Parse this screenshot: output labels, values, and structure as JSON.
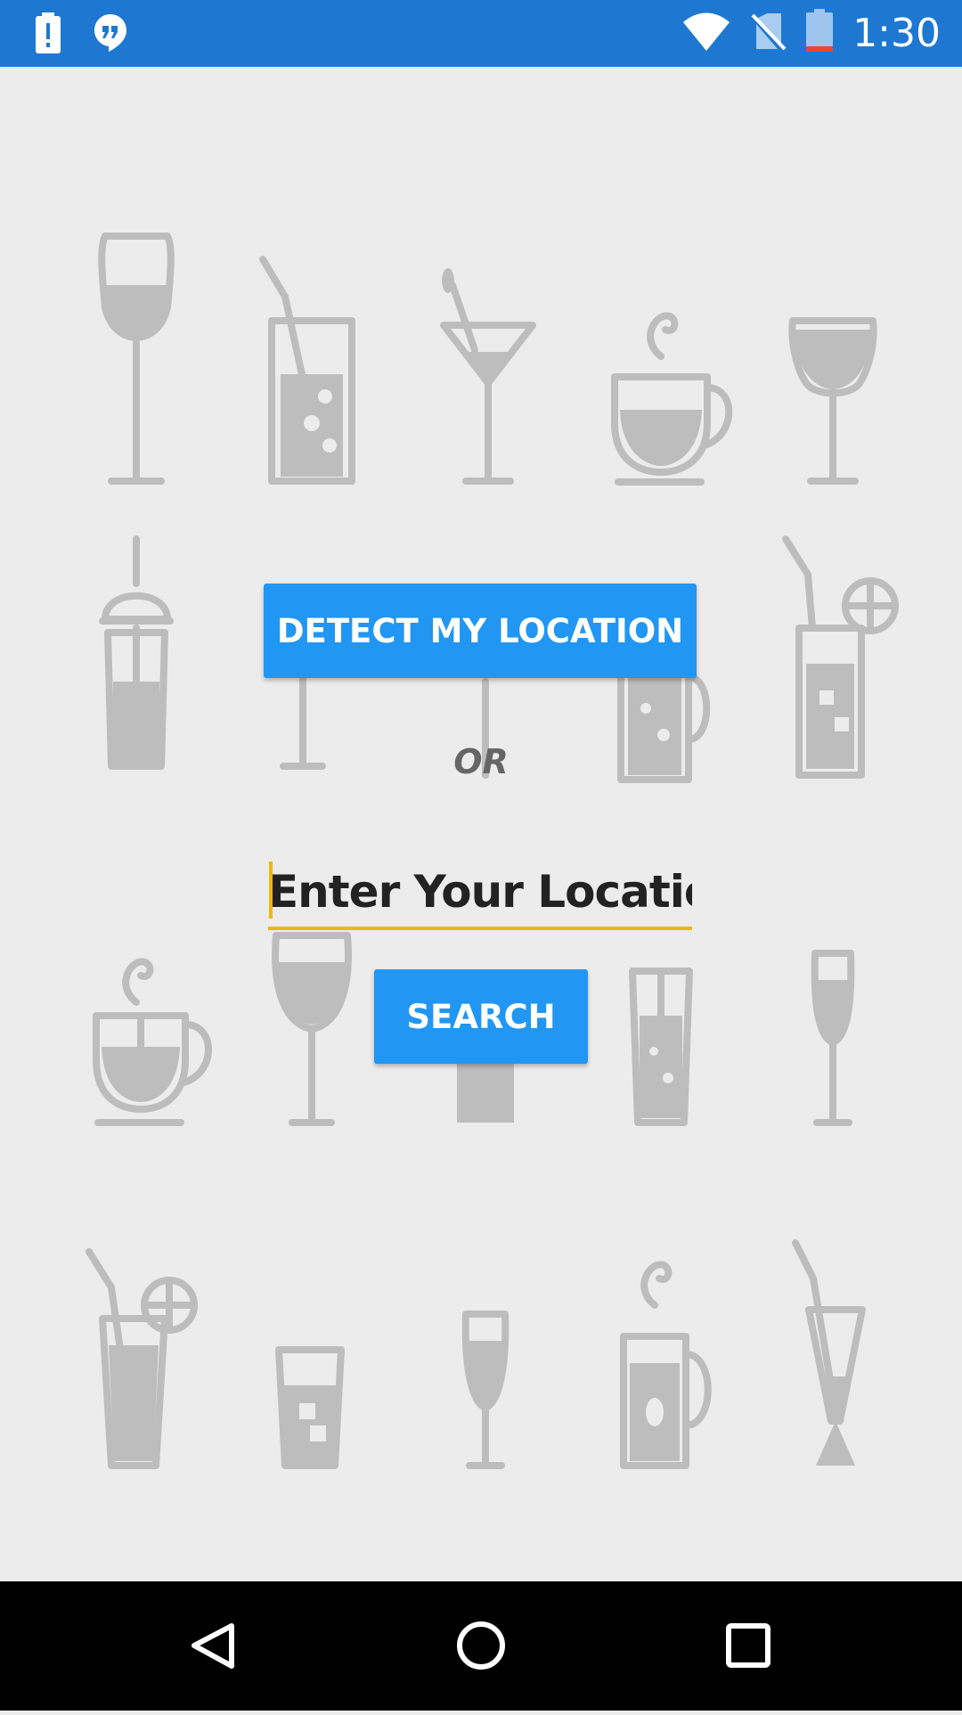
{
  "status_bar": {
    "time": "1:30",
    "left_icons": [
      "battery-alert-icon",
      "hangouts-icon"
    ],
    "right_icons": [
      "wifi-icon",
      "no-sim-icon",
      "battery-low-icon"
    ],
    "color": "#1e78d2"
  },
  "main": {
    "detect_button_label": "DETECT MY LOCATION",
    "or_label": "OR",
    "location_input": {
      "placeholder": "Enter Your Location",
      "value": ""
    },
    "search_button_label": "SEARCH",
    "accent_color": "#2196f3",
    "input_underline_color": "#f2b705",
    "background_pattern": "drinks-icons"
  },
  "nav_bar": {
    "buttons": [
      "back-icon",
      "home-icon",
      "recents-icon"
    ]
  }
}
